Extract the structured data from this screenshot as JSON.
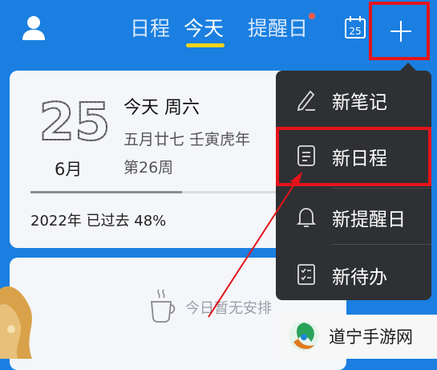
{
  "header": {
    "tabs": [
      {
        "label": "日程",
        "active": false
      },
      {
        "label": "今天",
        "active": true
      },
      {
        "label": "提醒日",
        "active": false,
        "has_badge": true
      }
    ],
    "calendar_badge": "25",
    "icons": {
      "avatar": "user-icon",
      "calendar": "calendar-icon",
      "add": "plus-icon"
    }
  },
  "date_card": {
    "day_number": "25",
    "month": "6月",
    "today_label": "今天 周六",
    "lunar_date": "五月廿七 壬寅虎年",
    "week_label": "第26周",
    "year_progress_label": "2022年 已过去 48%",
    "year_progress_fraction": 0.48
  },
  "schedule_card": {
    "empty_text": "今日暂无安排",
    "icon": "coffee-cup-icon"
  },
  "menu": {
    "items": [
      {
        "label": "新笔记",
        "icon": "pen-icon"
      },
      {
        "label": "新日程",
        "icon": "note-icon",
        "highlighted": true
      },
      {
        "label": "新提醒日",
        "icon": "bell-icon"
      },
      {
        "label": "新待办",
        "icon": "checklist-icon"
      }
    ]
  },
  "watermark": {
    "text": "道宁手游网"
  },
  "colors": {
    "accent_blue": "#1a7fe0",
    "tab_underline": "#f2d31b",
    "annotation_red": "#e5141b",
    "menu_bg": "#2e3033",
    "card_bg": "#f4f6fa"
  }
}
